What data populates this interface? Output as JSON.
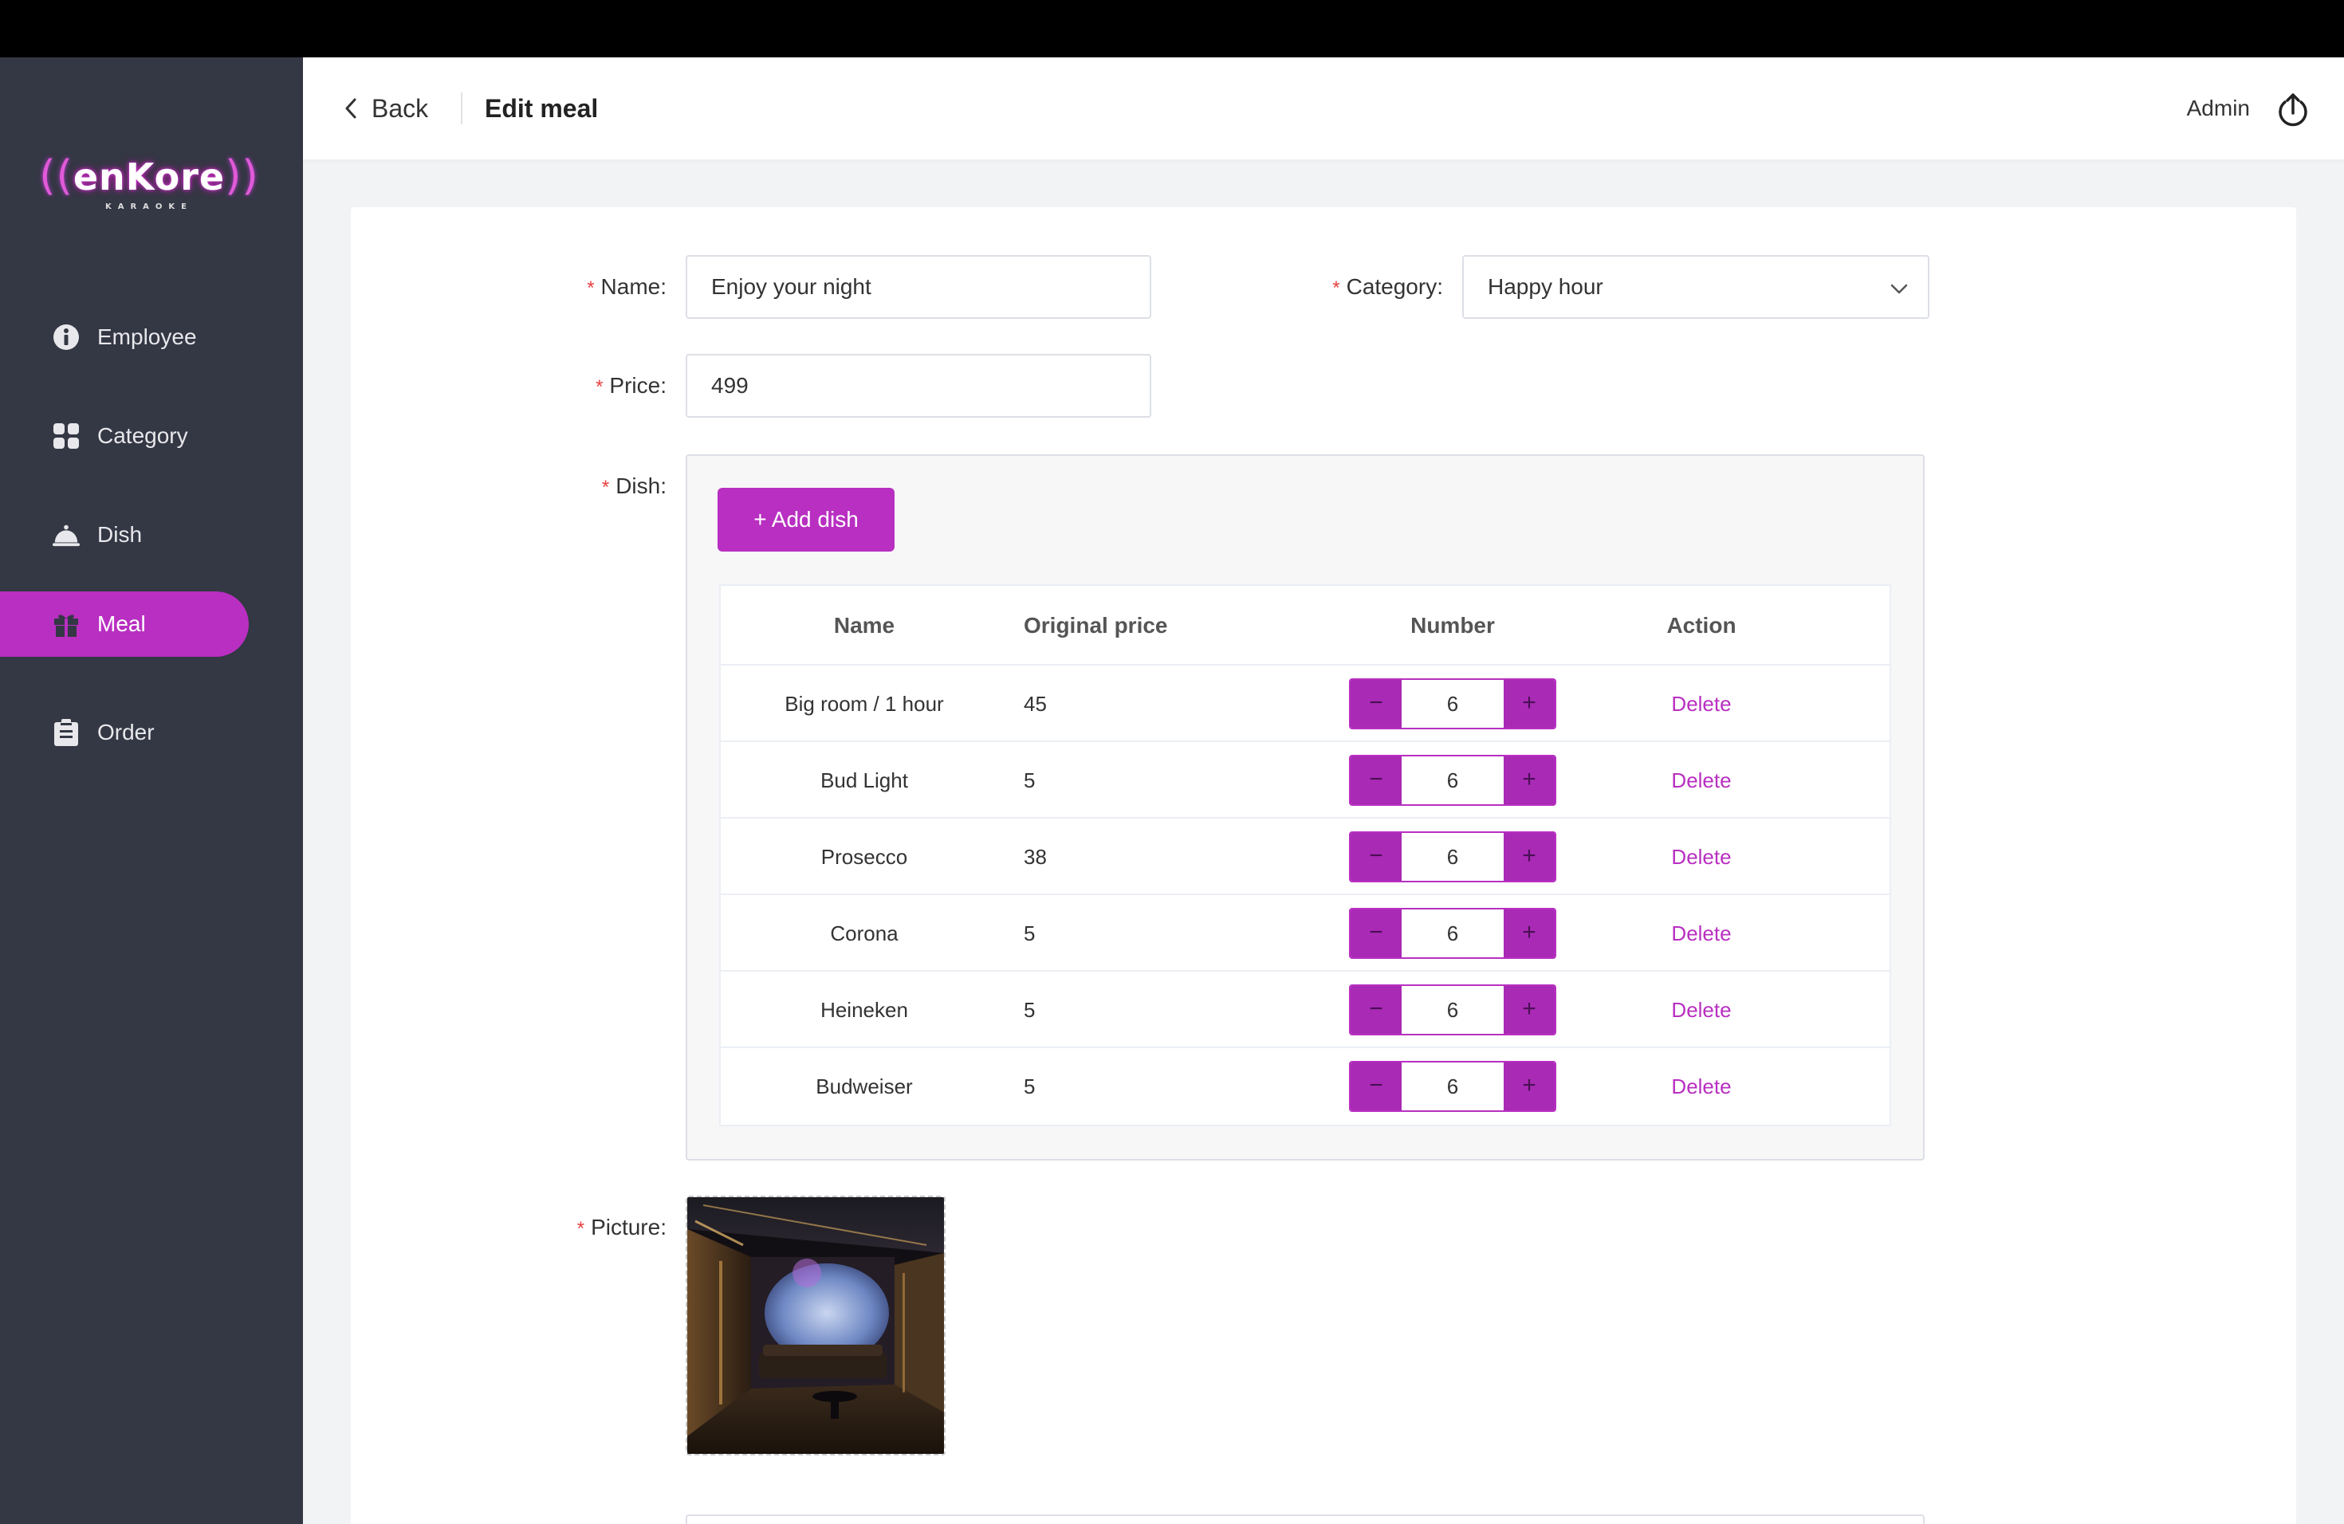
{
  "app": {
    "logo_text": "enKore",
    "logo_sub": "KARAOKE",
    "accent": "#b82fc1",
    "sidebar_bg": "#343744"
  },
  "sidebar": {
    "items": [
      {
        "label": "Employee",
        "icon": "info-icon"
      },
      {
        "label": "Category",
        "icon": "grid-icon"
      },
      {
        "label": "Dish",
        "icon": "cloche-icon"
      },
      {
        "label": "Meal",
        "icon": "gift-icon",
        "active": true
      },
      {
        "label": "Order",
        "icon": "clipboard-icon"
      }
    ]
  },
  "header": {
    "back_label": "Back",
    "title": "Edit meal",
    "user": "Admin"
  },
  "form": {
    "name_label": "Name:",
    "name_value": "Enjoy your night",
    "category_label": "Category:",
    "category_value": "Happy hour",
    "price_label": "Price:",
    "price_value": "499",
    "dish_label": "Dish:",
    "add_dish_label": "+ Add dish",
    "picture_label": "Picture:",
    "required_mark": "*"
  },
  "dish_table": {
    "columns": [
      "Name",
      "Original price",
      "Number",
      "Action"
    ],
    "rows": [
      {
        "name": "Big room / 1 hour",
        "price": "45",
        "number": "6",
        "action": "Delete"
      },
      {
        "name": "Bud Light",
        "price": "5",
        "number": "6",
        "action": "Delete"
      },
      {
        "name": "Prosecco",
        "price": "38",
        "number": "6",
        "action": "Delete"
      },
      {
        "name": "Corona",
        "price": "5",
        "number": "6",
        "action": "Delete"
      },
      {
        "name": "Heineken",
        "price": "5",
        "number": "6",
        "action": "Delete"
      },
      {
        "name": "Budweiser",
        "price": "5",
        "number": "6",
        "action": "Delete"
      }
    ],
    "minus": "−",
    "plus": "+"
  }
}
